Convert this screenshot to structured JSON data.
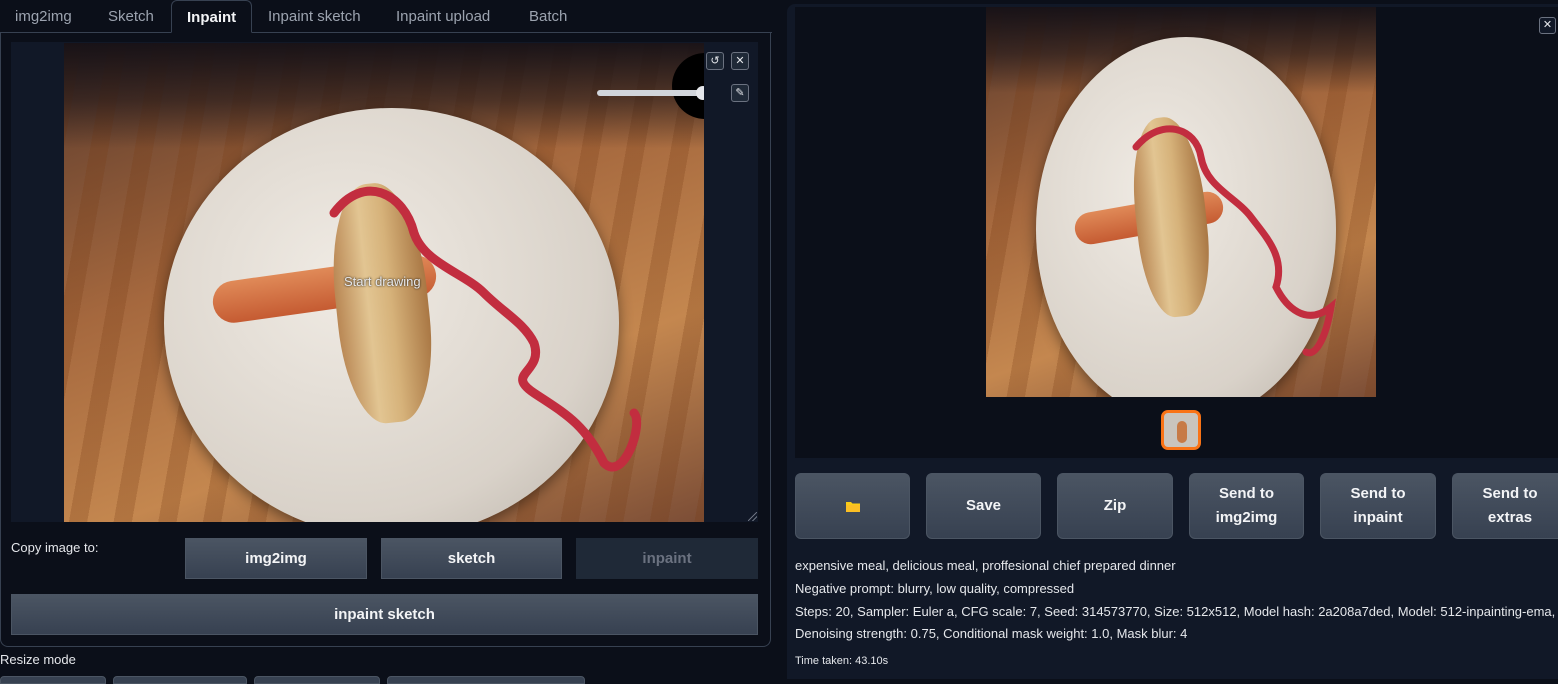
{
  "tabs": [
    "img2img",
    "Sketch",
    "Inpaint",
    "Inpaint sketch",
    "Inpaint upload",
    "Batch"
  ],
  "active_tab": "Inpaint",
  "canvas": {
    "placeholder": "Start drawing",
    "undo_icon": "undo-icon",
    "clear_icon": "close-icon",
    "brush_icon": "brush-icon"
  },
  "copy_image": {
    "label": "Copy image to:",
    "buttons": [
      "img2img",
      "sketch",
      "inpaint",
      "inpaint sketch"
    ]
  },
  "resize_mode_label": "Resize mode",
  "gallery": {
    "folder_icon": "folder-icon",
    "close_icon": "close-icon",
    "actions": {
      "save": "Save",
      "zip": "Zip",
      "send_img2img": [
        "Send to",
        "img2img"
      ],
      "send_inpaint": [
        "Send to",
        "inpaint"
      ],
      "send_extras": [
        "Send to",
        "extras"
      ]
    }
  },
  "generation_info": {
    "prompt": "expensive meal, delicious meal, proffesional chief prepared dinner",
    "negative_prompt": "Negative prompt: blurry, low quality, compressed",
    "params_line1": "Steps: 20, Sampler: Euler a, CFG scale: 7, Seed: 314573770, Size: 512x512, Model hash: 2a208a7ded, Model: 512-inpainting-ema,",
    "params_line2": "Denoising strength: 0.75, Conditional mask weight: 1.0, Mask blur: 4",
    "time_taken": "Time taken: 43.10s"
  },
  "colors": {
    "background": "#0b0f19",
    "panel": "#111827",
    "button": "#4b5563",
    "accent": "#f97316",
    "folder": "#facc15"
  }
}
